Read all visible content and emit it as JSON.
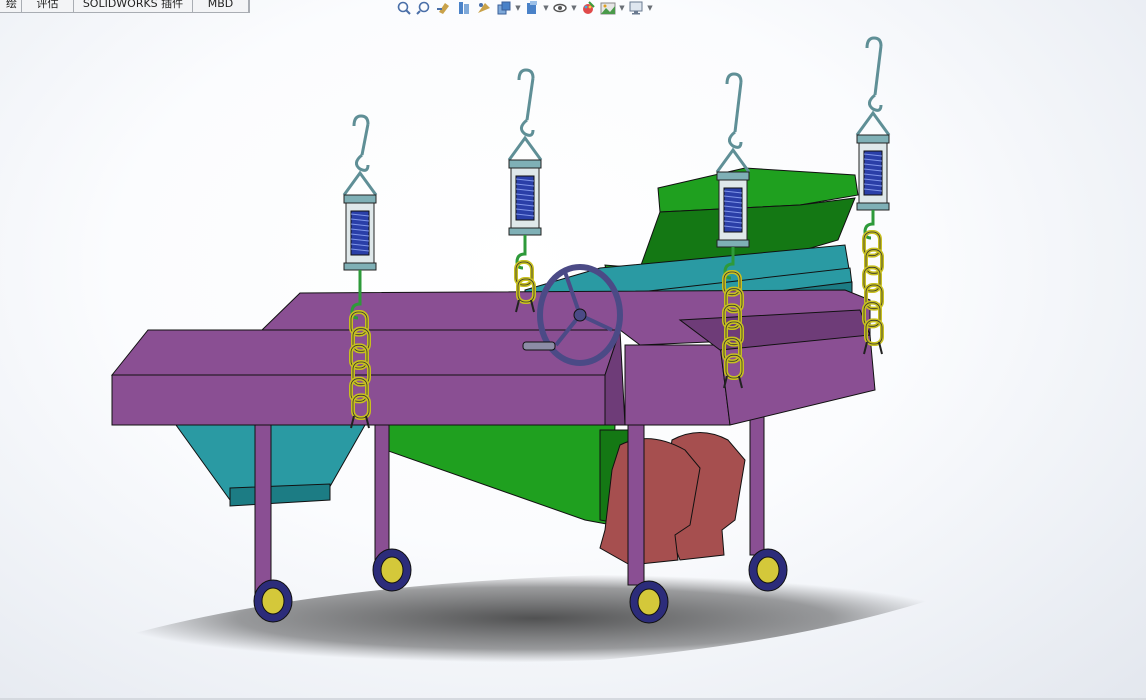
{
  "tabs": [
    {
      "label": "绘",
      "width": 22
    },
    {
      "label": "评估",
      "width": 52
    },
    {
      "label": "SOLIDWORKS 插件",
      "width": 119
    },
    {
      "label": "MBD",
      "width": 56
    }
  ],
  "heads_up_toolbar": [
    {
      "icon": "zoom-to-fit-icon",
      "dropdown": false
    },
    {
      "icon": "zoom-to-area-icon",
      "dropdown": false
    },
    {
      "icon": "previous-view-icon",
      "dropdown": false
    },
    {
      "icon": "section-view-icon",
      "dropdown": false
    },
    {
      "icon": "dynamic-annotation-views-icon",
      "dropdown": false
    },
    {
      "icon": "view-orientation-icon",
      "dropdown": true
    },
    {
      "icon": "display-style-icon",
      "dropdown": true
    },
    {
      "icon": "hide-show-items-icon",
      "dropdown": true
    },
    {
      "icon": "edit-appearance-icon",
      "dropdown": false
    },
    {
      "icon": "apply-scene-icon",
      "dropdown": true
    },
    {
      "icon": "view-settings-icon",
      "dropdown": true
    }
  ],
  "colors": {
    "frame_purple": "#8a4f93",
    "frame_purple_dark": "#6e3c78",
    "chute_green": "#1fa01f",
    "chute_green_dark": "#147814",
    "teal": "#2a9aa3",
    "teal_dark": "#1c7c84",
    "chain_yellow": "#c8c020",
    "hanger_steel": "#5f8f96",
    "spring_blue": "#2a3fa8",
    "motor_red": "#a64f4f",
    "wheel_yellow": "#d4c83a",
    "wheel_tire": "#2c2c7a",
    "handwheel": "#4b4a86"
  }
}
